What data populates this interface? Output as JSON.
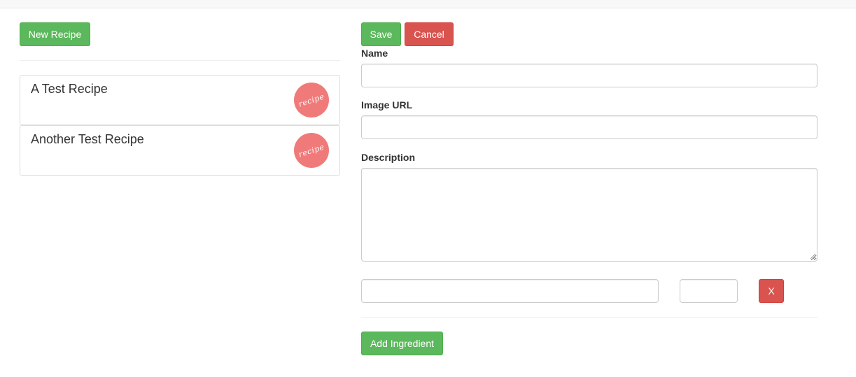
{
  "left_panel": {
    "new_recipe_label": "New Recipe",
    "recipes": [
      {
        "name": "A Test Recipe",
        "thumb_text": "recipe"
      },
      {
        "name": "Another Test Recipe",
        "thumb_text": "recipe"
      }
    ]
  },
  "form": {
    "save_label": "Save",
    "cancel_label": "Cancel",
    "name_label": "Name",
    "name_value": "",
    "image_url_label": "Image URL",
    "image_url_value": "",
    "description_label": "Description",
    "description_value": "",
    "ingredients": [
      {
        "name": "",
        "amount": "",
        "remove_label": "X"
      }
    ],
    "add_ingredient_label": "Add Ingredient"
  },
  "colors": {
    "success": "#5cb85c",
    "danger": "#d9534f",
    "thumb": "#f07a7a"
  },
  "icons": {
    "recipe_thumb": "recipe-badge-icon",
    "resize_grip": "resize-grip-icon"
  }
}
